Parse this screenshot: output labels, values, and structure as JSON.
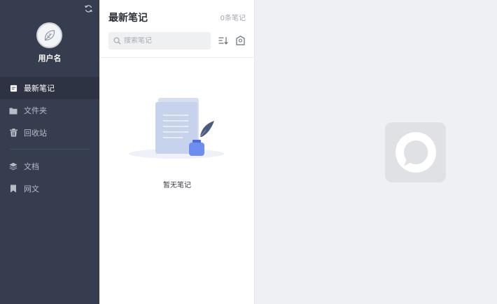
{
  "user": {
    "name": "用户名"
  },
  "sidebar": {
    "items": [
      {
        "label": "最新笔记",
        "icon": "document-icon",
        "active": true
      },
      {
        "label": "文件夹",
        "icon": "folder-icon",
        "active": false
      },
      {
        "label": "回收站",
        "icon": "trash-icon",
        "active": false
      },
      {
        "label": "文档",
        "icon": "layers-icon",
        "active": false
      },
      {
        "label": "网文",
        "icon": "bookmark-icon",
        "active": false
      }
    ]
  },
  "notes": {
    "title": "最新笔记",
    "count": "0条笔记",
    "search_placeholder": "搜索笔记",
    "empty_text": "暂无笔记"
  },
  "colors": {
    "sidebar_bg": "#363d4f",
    "sidebar_active": "#2d3343",
    "accent": "#5b7be6"
  }
}
